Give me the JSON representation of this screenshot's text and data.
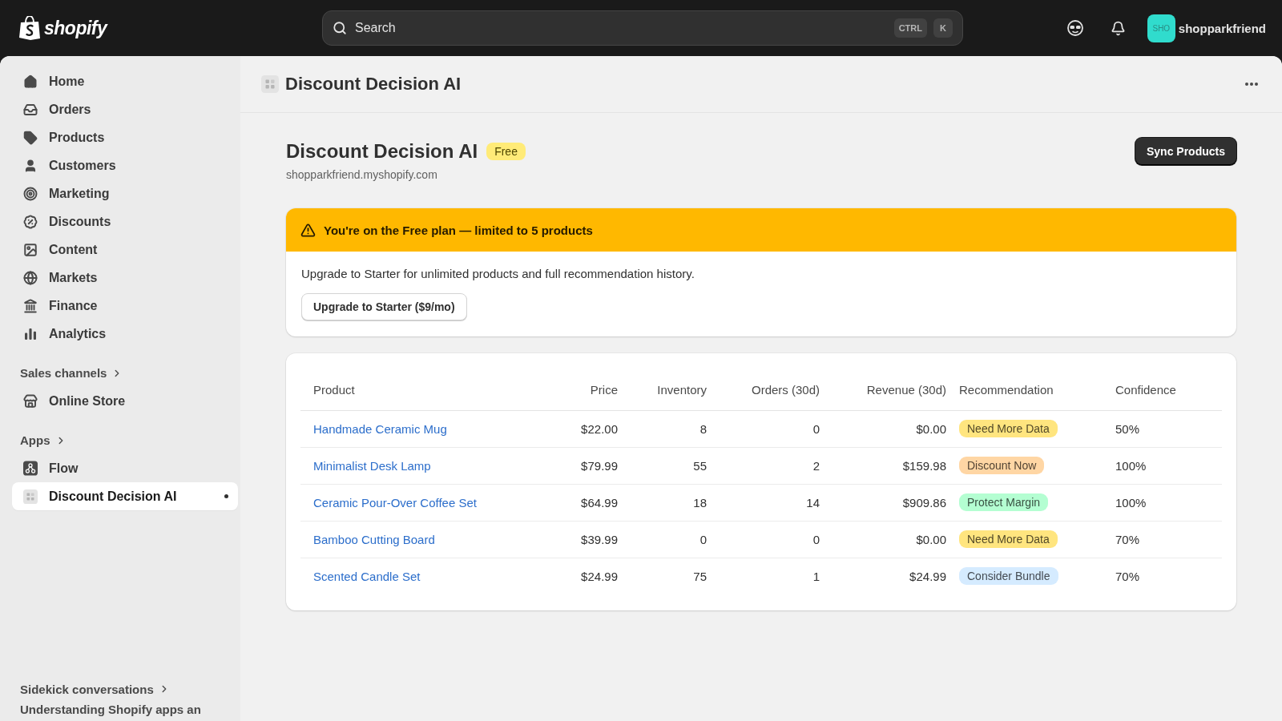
{
  "top_bar": {
    "logo_text": "shopify",
    "search": {
      "placeholder": "Search",
      "shortcut_keys": [
        "CTRL",
        "K"
      ]
    },
    "account": {
      "initials": "SHO",
      "name": "shopparkfriend"
    }
  },
  "sidebar": {
    "items": [
      {
        "label": "Home",
        "selected": false
      },
      {
        "label": "Orders",
        "selected": false
      },
      {
        "label": "Products",
        "selected": false
      },
      {
        "label": "Customers",
        "selected": false
      },
      {
        "label": "Marketing",
        "selected": false
      },
      {
        "label": "Discounts",
        "selected": false
      },
      {
        "label": "Content",
        "selected": false
      },
      {
        "label": "Markets",
        "selected": false
      },
      {
        "label": "Finance",
        "selected": false
      },
      {
        "label": "Analytics",
        "selected": false
      }
    ],
    "sections": [
      {
        "title": "Sales channels",
        "items": [
          {
            "label": "Online Store",
            "selected": false
          }
        ]
      },
      {
        "title": "Apps",
        "items": [
          {
            "label": "Flow",
            "selected": false
          },
          {
            "label": "Discount Decision AI",
            "selected": true
          }
        ]
      }
    ],
    "footer": {
      "title": "Sidekick conversations",
      "items": [
        "Understanding Shopify apps an"
      ]
    }
  },
  "app_header": {
    "title": "Discount Decision AI"
  },
  "page": {
    "title": "Discount Decision AI",
    "badge": "Free",
    "subtitle": "shopparkfriend.myshopify.com",
    "primary_action": "Sync Products"
  },
  "banner": {
    "title": "You're on the Free plan — limited to 5 products",
    "body": "Upgrade to Starter for unlimited products and full recommendation history.",
    "action": "Upgrade to Starter ($9/mo)"
  },
  "table": {
    "columns": [
      "Product",
      "Price",
      "Inventory",
      "Orders (30d)",
      "Revenue (30d)",
      "Recommendation",
      "Confidence"
    ],
    "rows": [
      {
        "product": "Handmade Ceramic Mug",
        "price": "$22.00",
        "inventory": "8",
        "orders_30d": "0",
        "revenue_30d": "$0.00",
        "recommendation": {
          "label": "Need More Data",
          "color": "#ffe57f"
        },
        "confidence": "50%"
      },
      {
        "product": "Minimalist Desk Lamp",
        "price": "$79.99",
        "inventory": "55",
        "orders_30d": "2",
        "revenue_30d": "$159.98",
        "recommendation": {
          "label": "Discount Now",
          "color": "#ffd6a4"
        },
        "confidence": "100%"
      },
      {
        "product": "Ceramic Pour-Over Coffee Set",
        "price": "$64.99",
        "inventory": "18",
        "orders_30d": "14",
        "revenue_30d": "$909.86",
        "recommendation": {
          "label": "Protect Margin",
          "color": "#b4fed2"
        },
        "confidence": "100%"
      },
      {
        "product": "Bamboo Cutting Board",
        "price": "$39.99",
        "inventory": "0",
        "orders_30d": "0",
        "revenue_30d": "$0.00",
        "recommendation": {
          "label": "Need More Data",
          "color": "#ffe57f"
        },
        "confidence": "70%"
      },
      {
        "product": "Scented Candle Set",
        "price": "$24.99",
        "inventory": "75",
        "orders_30d": "1",
        "revenue_30d": "$24.99",
        "recommendation": {
          "label": "Consider Bundle",
          "color": "#d5ebff"
        },
        "confidence": "70%"
      }
    ]
  }
}
